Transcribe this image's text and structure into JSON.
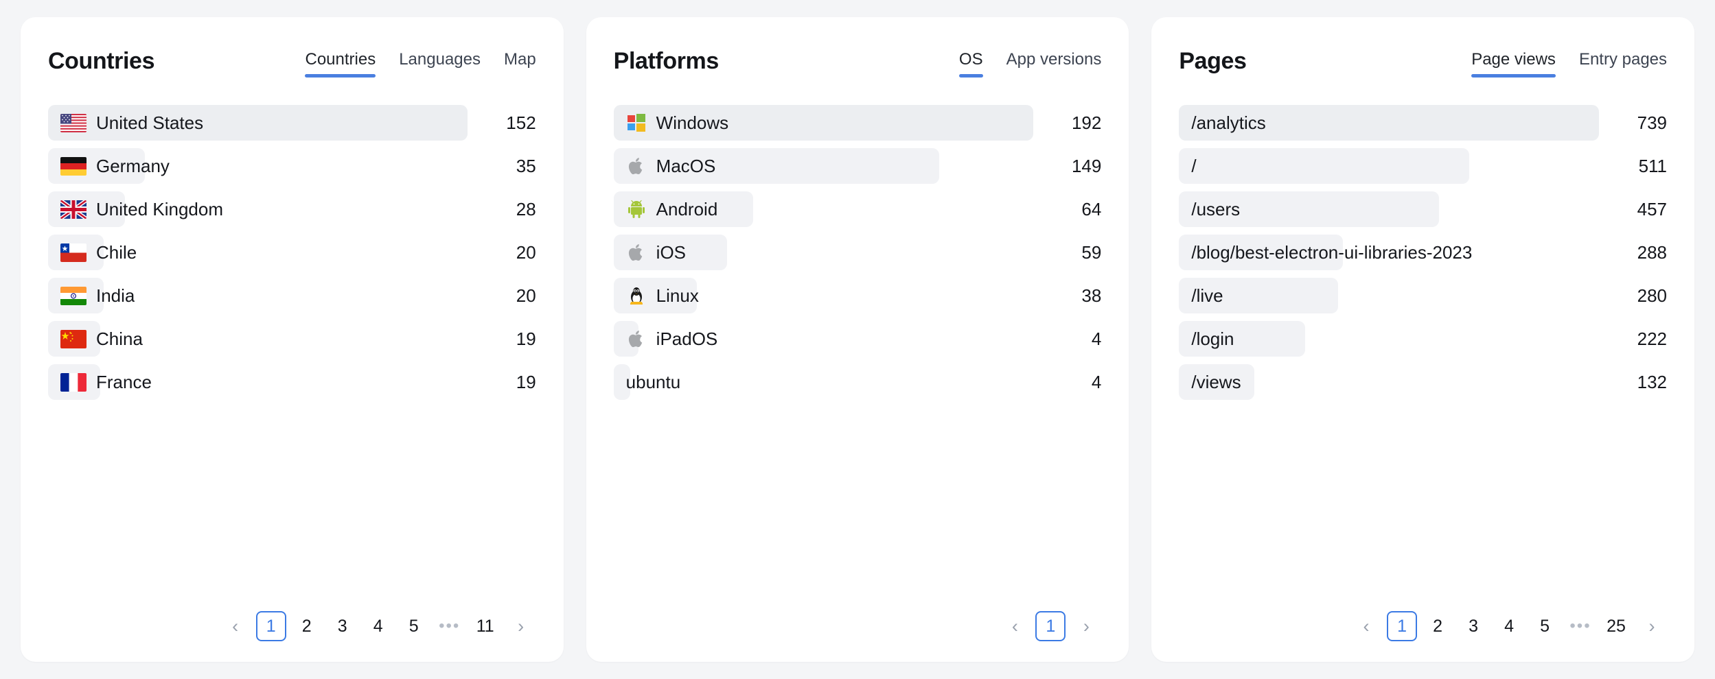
{
  "cards": [
    {
      "title": "Countries",
      "tabs": [
        {
          "label": "Countries",
          "active": true
        },
        {
          "label": "Languages",
          "active": false
        },
        {
          "label": "Map",
          "active": false
        }
      ],
      "rows": [
        {
          "label": "United States",
          "value": "152",
          "icon": "flag-us",
          "bar_pct": 100
        },
        {
          "label": "Germany",
          "value": "35",
          "icon": "flag-de",
          "bar_pct": 23
        },
        {
          "label": "United Kingdom",
          "value": "28",
          "icon": "flag-gb",
          "bar_pct": 18.4
        },
        {
          "label": "Chile",
          "value": "20",
          "icon": "flag-cl",
          "bar_pct": 13.2
        },
        {
          "label": "India",
          "value": "20",
          "icon": "flag-in",
          "bar_pct": 13.2
        },
        {
          "label": "China",
          "value": "19",
          "icon": "flag-cn",
          "bar_pct": 12.5
        },
        {
          "label": "France",
          "value": "19",
          "icon": "flag-fr",
          "bar_pct": 12.5
        }
      ],
      "pagination": {
        "prev": "‹",
        "next": "›",
        "dots": "•••",
        "pages": [
          "1",
          "2",
          "3",
          "4",
          "5"
        ],
        "last": "11",
        "current": "1"
      }
    },
    {
      "title": "Platforms",
      "tabs": [
        {
          "label": "OS",
          "active": true
        },
        {
          "label": "App versions",
          "active": false
        }
      ],
      "rows": [
        {
          "label": "Windows",
          "value": "192",
          "icon": "windows-icon",
          "bar_pct": 100
        },
        {
          "label": "MacOS",
          "value": "149",
          "icon": "apple-icon",
          "bar_pct": 77.6
        },
        {
          "label": "Android",
          "value": "64",
          "icon": "android-icon",
          "bar_pct": 33.3
        },
        {
          "label": "iOS",
          "value": "59",
          "icon": "apple-icon",
          "bar_pct": 27
        },
        {
          "label": "Linux",
          "value": "38",
          "icon": "linux-icon",
          "bar_pct": 19.8
        },
        {
          "label": "iPadOS",
          "value": "4",
          "icon": "apple-icon",
          "bar_pct": 6
        },
        {
          "label": "ubuntu",
          "value": "4",
          "icon": "none",
          "bar_pct": 4
        }
      ],
      "pagination": {
        "prev": "‹",
        "next": "›",
        "dots": "",
        "pages": [
          "1"
        ],
        "last": "",
        "current": "1"
      }
    },
    {
      "title": "Pages",
      "tabs": [
        {
          "label": "Page views",
          "active": true
        },
        {
          "label": "Entry pages",
          "active": false
        }
      ],
      "rows": [
        {
          "label": "/analytics",
          "value": "739",
          "icon": "none",
          "bar_pct": 100
        },
        {
          "label": "/",
          "value": "511",
          "icon": "none",
          "bar_pct": 69.2
        },
        {
          "label": "/users",
          "value": "457",
          "icon": "none",
          "bar_pct": 61.9
        },
        {
          "label": "/blog/best-electron-ui-libraries-2023",
          "value": "288",
          "icon": "none",
          "bar_pct": 39
        },
        {
          "label": "/live",
          "value": "280",
          "icon": "none",
          "bar_pct": 37.9
        },
        {
          "label": "/login",
          "value": "222",
          "icon": "none",
          "bar_pct": 30
        },
        {
          "label": "/views",
          "value": "132",
          "icon": "none",
          "bar_pct": 17.9
        }
      ],
      "pagination": {
        "prev": "‹",
        "next": "›",
        "dots": "•••",
        "pages": [
          "1",
          "2",
          "3",
          "4",
          "5"
        ],
        "last": "25",
        "current": "1"
      }
    }
  ],
  "colors": {
    "accent": "#4a7fe0",
    "page_bg": "#f4f5f7",
    "card_bg": "#ffffff",
    "bar": "#f1f2f5",
    "bar_first": "#eceef1",
    "text": "#15171c"
  }
}
